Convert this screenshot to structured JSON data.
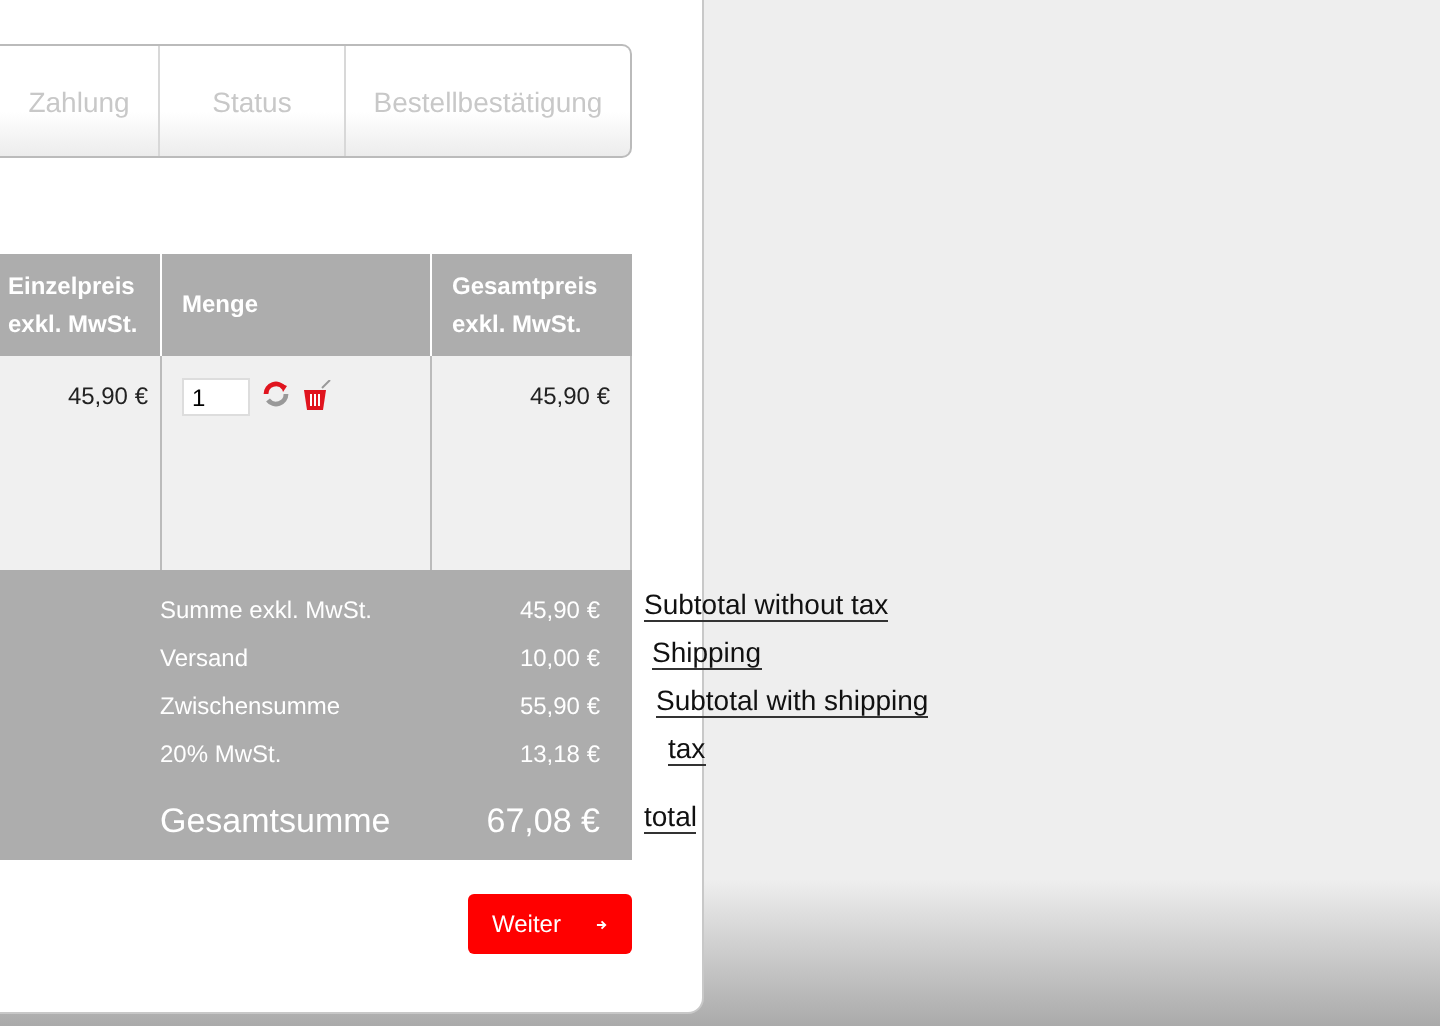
{
  "steps": [
    {
      "label": "Zahlung"
    },
    {
      "label": "Status"
    },
    {
      "label": "Bestellbestätigung"
    }
  ],
  "table": {
    "columns": [
      {
        "lines": [
          "Einzelpreis",
          "exkl. MwSt."
        ]
      },
      {
        "lines": [
          "Menge"
        ]
      },
      {
        "lines": [
          "Gesamtpreis",
          "exkl. MwSt."
        ]
      }
    ],
    "rows": [
      {
        "unit_price": "45,90 €",
        "quantity": "1",
        "total": "45,90 €"
      }
    ]
  },
  "summary": [
    {
      "kind": "line",
      "label": "Summe exkl. MwSt.",
      "value": "45,90 €",
      "note": "Subtotal without tax"
    },
    {
      "kind": "line",
      "label": "Versand",
      "value": "10,00 €",
      "note": "Shipping"
    },
    {
      "kind": "line",
      "label": "Zwischensumme",
      "value": "55,90 €",
      "note": "Subtotal with shipping"
    },
    {
      "kind": "line",
      "label": "20% MwSt.",
      "value": "13,18 €",
      "note": "tax"
    },
    {
      "kind": "total",
      "label": "Gesamtsumme",
      "value": "67,08 €",
      "note": "total"
    }
  ],
  "button": {
    "label": "Weiter"
  }
}
